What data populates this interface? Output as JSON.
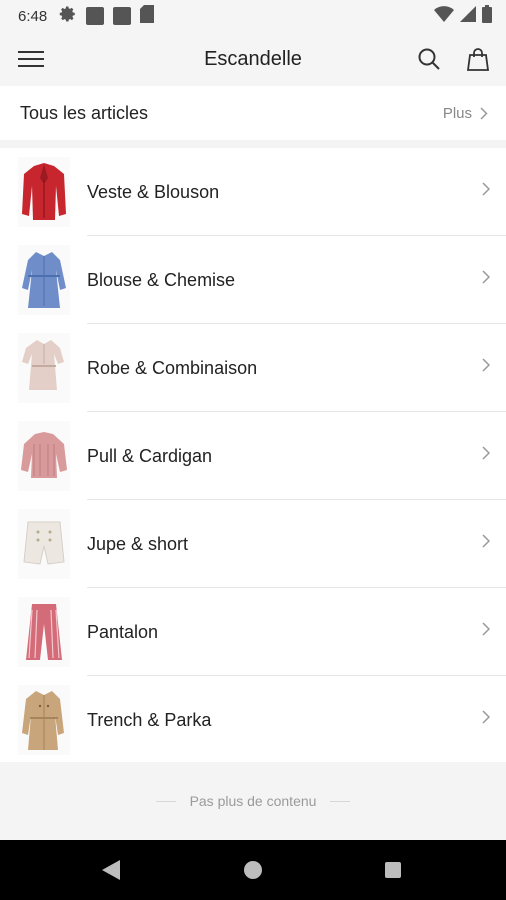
{
  "status_bar": {
    "time": "6:48",
    "left_icons": [
      "settings-icon",
      "notification-square-icon",
      "notification-square-icon",
      "sd-card-icon"
    ],
    "right_icons": [
      "wifi-icon",
      "signal-icon",
      "battery-icon"
    ]
  },
  "app_bar": {
    "title": "Escandelle",
    "icons": [
      "menu-icon",
      "search-icon",
      "shopping-bag-icon"
    ]
  },
  "all_articles": {
    "title": "Tous les articles",
    "more_label": "Plus"
  },
  "categories": [
    {
      "label": "Veste & Blouson",
      "image": "red-jacket",
      "color": "#c8262e"
    },
    {
      "label": "Blouse &  Chemise",
      "image": "blue-shirt-dress",
      "color": "#6f8ec9"
    },
    {
      "label": "Robe & Combinaison",
      "image": "beige-shirt-dress",
      "color": "#e3cfc7"
    },
    {
      "label": "Pull & Cardigan",
      "image": "pink-cardigan",
      "color": "#d99a9c"
    },
    {
      "label": "Jupe & short",
      "image": "white-shorts",
      "color": "#ece8e1"
    },
    {
      "label": "Pantalon",
      "image": "pink-striped-trousers",
      "color": "#d46b78"
    },
    {
      "label": "Trench & Parka",
      "image": "beige-trench-coat",
      "color": "#c9a57c"
    }
  ],
  "footer": {
    "text": "Pas plus de contenu"
  },
  "nav_bar": {
    "icons": [
      "back-icon",
      "home-icon",
      "recents-icon"
    ]
  }
}
